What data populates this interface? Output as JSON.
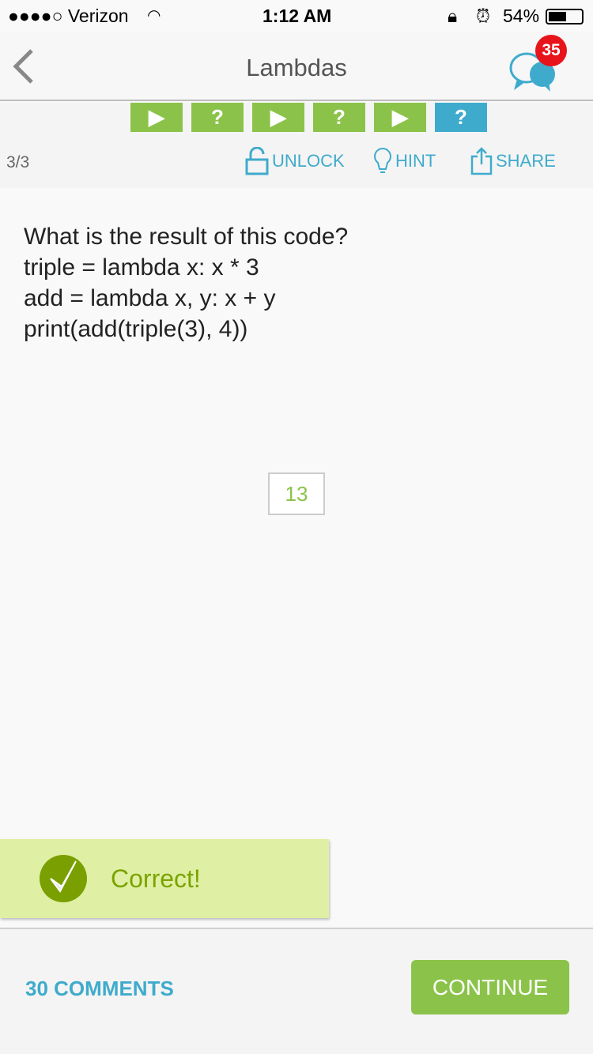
{
  "status": {
    "carrier": "●●●●○ Verizon",
    "time": "1:12 AM",
    "battery": "54%"
  },
  "nav": {
    "title": "Lambdas",
    "badge": "35"
  },
  "steps": [
    {
      "glyph": "▶",
      "state": "done"
    },
    {
      "glyph": "?",
      "state": "done"
    },
    {
      "glyph": "▶",
      "state": "done"
    },
    {
      "glyph": "?",
      "state": "done"
    },
    {
      "glyph": "▶",
      "state": "done"
    },
    {
      "glyph": "?",
      "state": "active"
    }
  ],
  "toolbar": {
    "count": "3/3",
    "unlock": "UNLOCK",
    "hint": "HINT",
    "share": "SHARE"
  },
  "question": {
    "lines": [
      "What is the result of this code?",
      "triple = lambda x: x * 3",
      "add = lambda x, y: x + y",
      "print(add(triple(3), 4))"
    ]
  },
  "answer": "13",
  "result": "Correct!",
  "footer": {
    "comments": "30 COMMENTS",
    "continue": "CONTINUE"
  },
  "colors": {
    "green": "#8bc34a",
    "blue": "#3fabcc",
    "badge": "#e8141b"
  }
}
